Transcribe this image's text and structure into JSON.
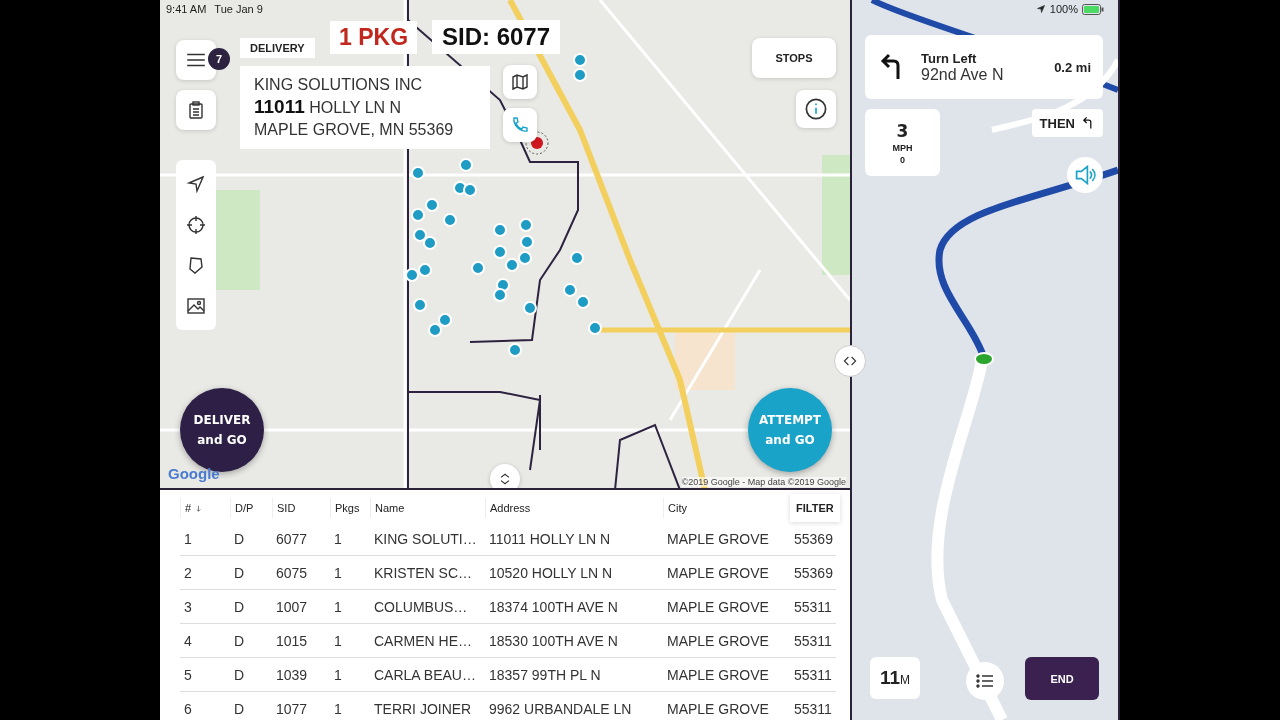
{
  "status_bar": {
    "time": "9:41 AM",
    "date": "Tue Jan 9",
    "battery": "100%"
  },
  "map_panel": {
    "menu_badge": "7",
    "stop_type": "DELIVERY",
    "packages": "1 PKG",
    "sid": "SID: 6077",
    "address": {
      "name": "KING SOLUTIONS INC",
      "street": "**11011** HOLLY LN N",
      "city_line": "MAPLE GROVE, MN  55369"
    },
    "stops_button": "STOPS",
    "deliver_button": {
      "line1": "DELIVER",
      "line2": "and GO"
    },
    "attempt_button": {
      "line1": "ATTEMPT",
      "line2": "and GO"
    },
    "logo": "Google",
    "attribution": "©2019 Google - Map data ©2019 Google"
  },
  "table": {
    "columns": [
      "#",
      "D/P",
      "SID",
      "Pkgs",
      "Name",
      "Address",
      "City"
    ],
    "filter_button": "FILTER",
    "rows": [
      [
        "1",
        "D",
        "6077",
        "1",
        "KING SOLUTI…",
        "11011 HOLLY LN N",
        "MAPLE GROVE",
        "55369"
      ],
      [
        "2",
        "D",
        "6075",
        "1",
        "KRISTEN SC…",
        "10520 HOLLY LN N",
        "MAPLE GROVE",
        "55369"
      ],
      [
        "3",
        "D",
        "1007",
        "1",
        "COLUMBUS…",
        "18374 100TH AVE N",
        "MAPLE GROVE",
        "55311"
      ],
      [
        "4",
        "D",
        "1015",
        "1",
        "CARMEN HE…",
        "18530 100TH AVE N",
        "MAPLE GROVE",
        "55311"
      ],
      [
        "5",
        "D",
        "1039",
        "1",
        "CARLA BEAU…",
        "18357 99TH PL N",
        "MAPLE GROVE",
        "55311"
      ],
      [
        "6",
        "D",
        "1077",
        "1",
        "TERRI JOINER",
        "9962 URBANDALE LN",
        "MAPLE GROVE",
        "55311"
      ]
    ]
  },
  "navigation": {
    "maneuver": "Turn Left",
    "street": "92nd Ave N",
    "distance": "0.2 mi",
    "then_label": "THEN",
    "speed": "3",
    "speed_unit": "MPH",
    "speed_limit": "0",
    "eta_value": "11",
    "eta_unit": "M",
    "end_button": "END"
  }
}
